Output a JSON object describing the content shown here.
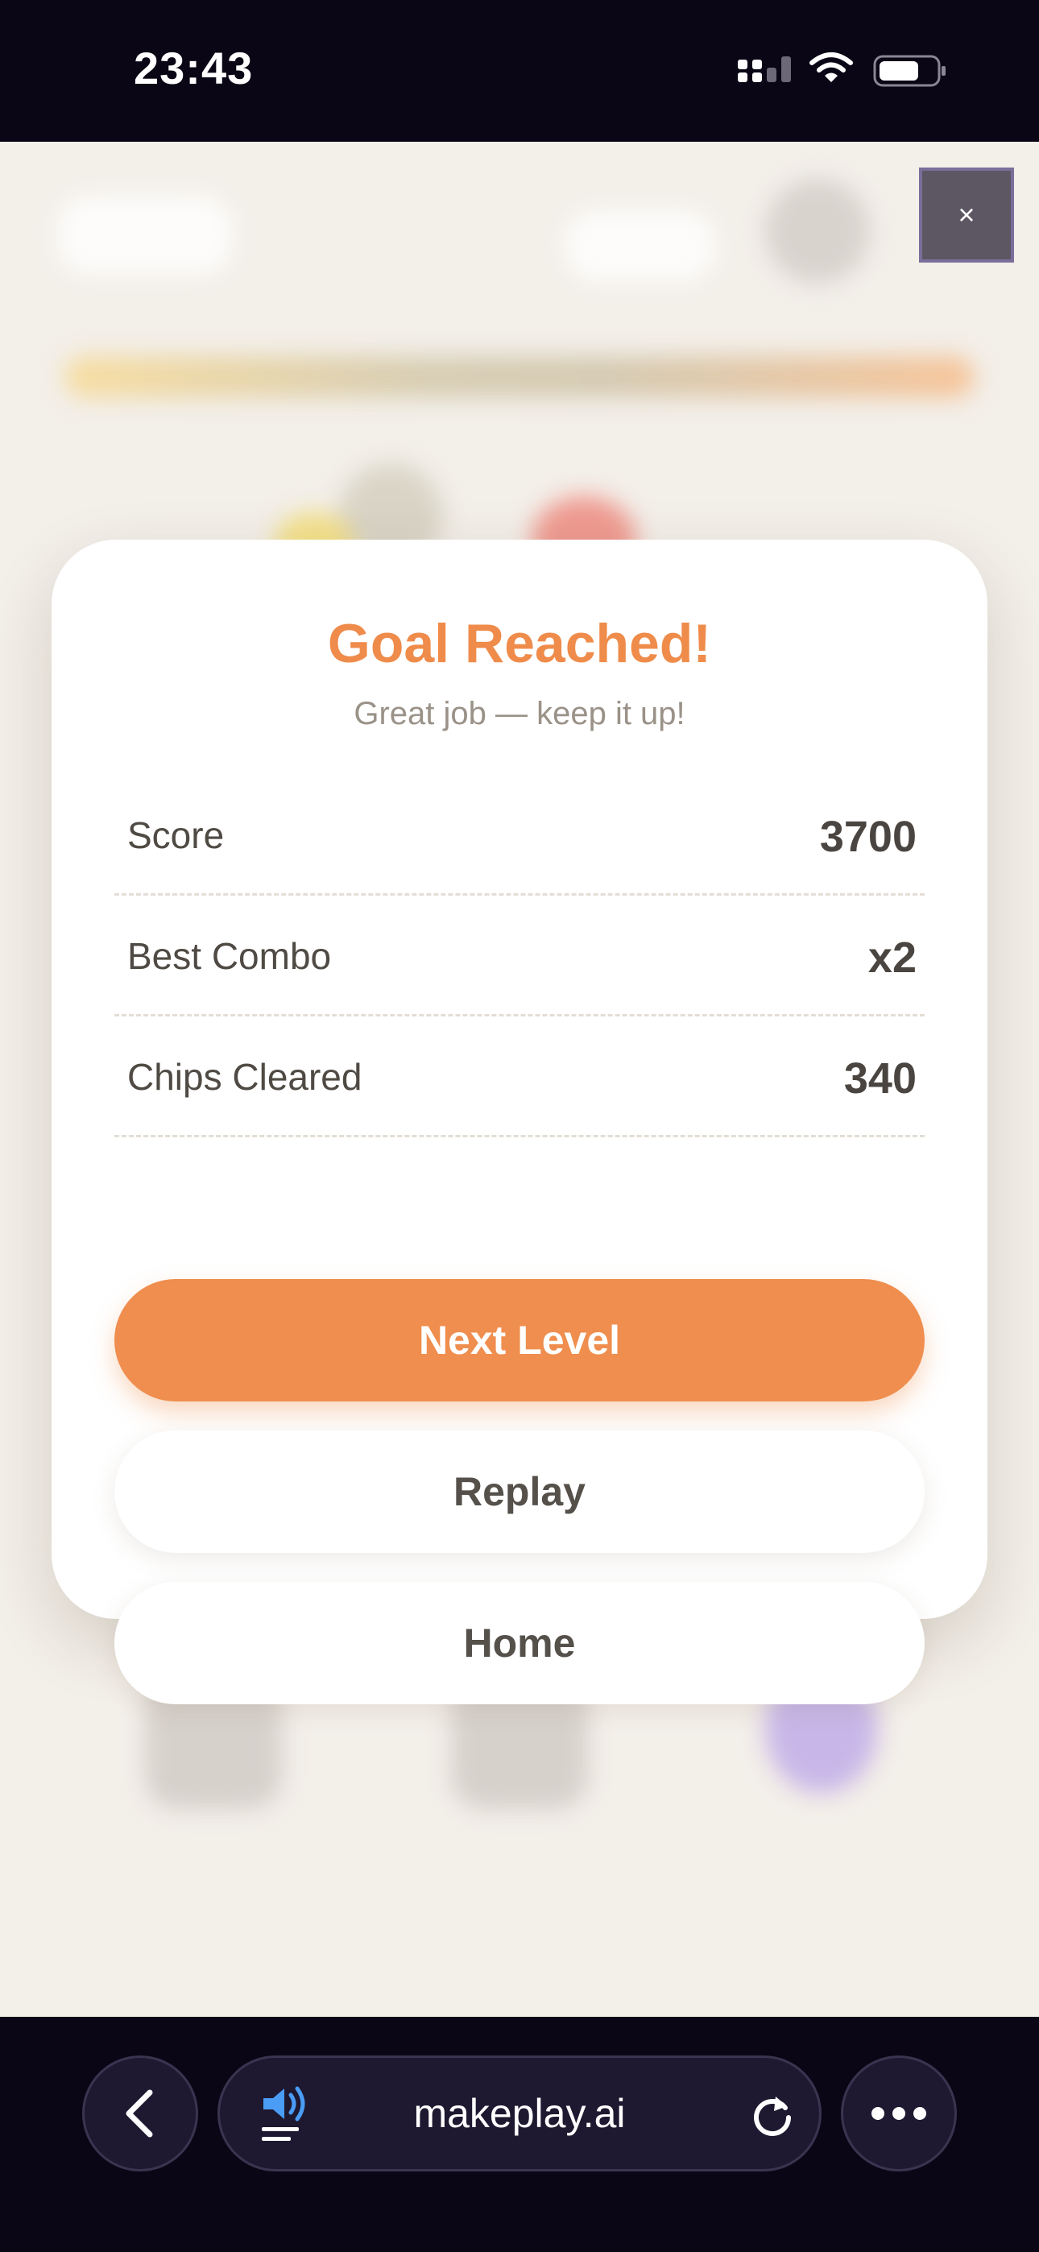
{
  "status": {
    "time": "23:43"
  },
  "overlay": {
    "close_label": "×"
  },
  "modal": {
    "title": "Goal Reached!",
    "subtitle": "Great job — keep it up!",
    "stats": [
      {
        "label": "Score",
        "value": "3700"
      },
      {
        "label": "Best Combo",
        "value": "x2"
      },
      {
        "label": "Chips Cleared",
        "value": "340"
      }
    ],
    "buttons": {
      "next": "Next Level",
      "replay": "Replay",
      "home": "Home"
    }
  },
  "browser": {
    "url": "makeplay.ai"
  },
  "colors": {
    "accent": "#ef8c4b",
    "background": "#f3efe9",
    "chrome": "#0a0616"
  },
  "icons": [
    "signal-icon",
    "wifi-icon",
    "battery-icon",
    "close-icon",
    "back-icon",
    "speaker-icon",
    "reload-icon",
    "more-icon"
  ]
}
